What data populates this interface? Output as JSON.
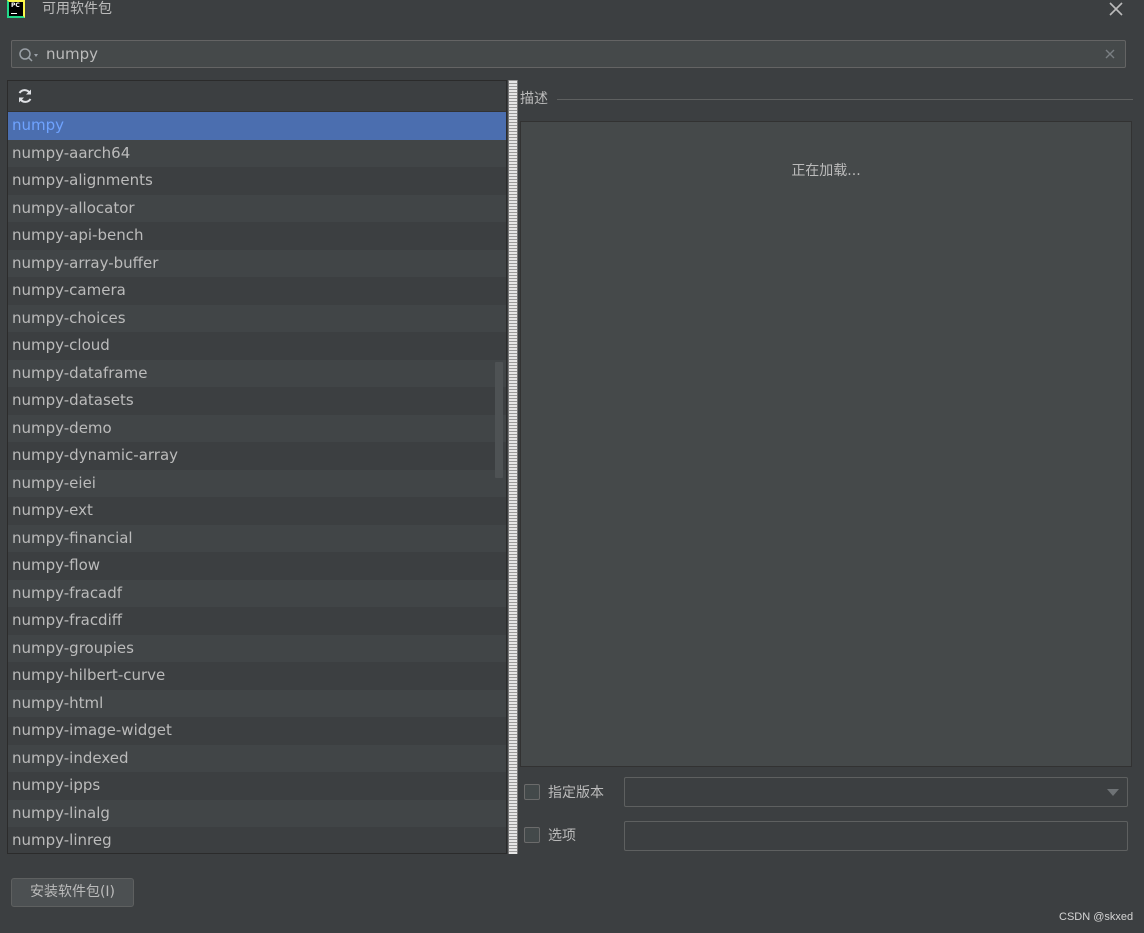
{
  "window": {
    "title": "可用软件包",
    "app_icon": "pycharm-logo",
    "app_icon_text": "PC"
  },
  "search": {
    "value": "numpy",
    "placeholder": ""
  },
  "packages": [
    "numpy",
    "numpy-aarch64",
    "numpy-alignments",
    "numpy-allocator",
    "numpy-api-bench",
    "numpy-array-buffer",
    "numpy-camera",
    "numpy-choices",
    "numpy-cloud",
    "numpy-dataframe",
    "numpy-datasets",
    "numpy-demo",
    "numpy-dynamic-array",
    "numpy-eiei",
    "numpy-ext",
    "numpy-financial",
    "numpy-flow",
    "numpy-fracadf",
    "numpy-fracdiff",
    "numpy-groupies",
    "numpy-hilbert-curve",
    "numpy-html",
    "numpy-image-widget",
    "numpy-indexed",
    "numpy-ipps",
    "numpy-linalg",
    "numpy-linreg"
  ],
  "selected_package": "numpy",
  "description": {
    "label": "描述",
    "loading_text": "正在加载..."
  },
  "options": {
    "specify_version_label": "指定版本",
    "specify_version_checked": false,
    "version_value": "",
    "options_label": "选项",
    "options_checked": false,
    "options_value": ""
  },
  "install_button_label": "安装软件包(I)",
  "watermark": "CSDN @skxed",
  "colors": {
    "background": "#3c3f41",
    "selection": "#4b6eaf",
    "selected_text": "#6fa3ff",
    "text": "#bbbbbb"
  },
  "icons": [
    "search-icon",
    "clear-icon",
    "refresh-icon",
    "close-icon",
    "dropdown-arrow-icon"
  ]
}
